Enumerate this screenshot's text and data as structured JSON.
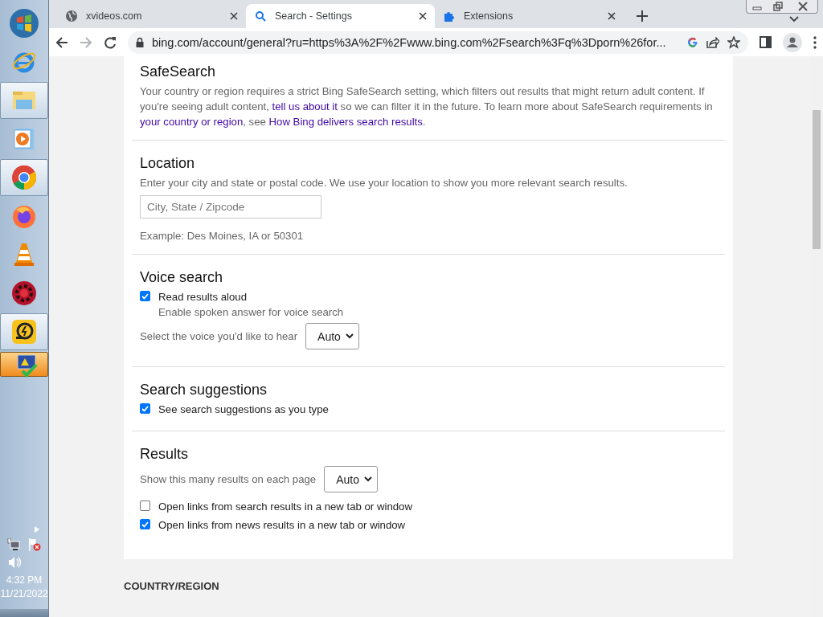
{
  "taskbar": {
    "items": [
      {
        "kind": "start",
        "running": false,
        "selected": false
      },
      {
        "kind": "ie",
        "running": false,
        "selected": false
      },
      {
        "kind": "folder",
        "running": true,
        "selected": false
      },
      {
        "kind": "media",
        "running": false,
        "selected": false
      },
      {
        "kind": "chrome",
        "running": true,
        "selected": false
      },
      {
        "kind": "firefox",
        "running": false,
        "selected": false
      },
      {
        "kind": "cone",
        "running": false,
        "selected": false
      },
      {
        "kind": "gear",
        "running": false,
        "selected": false
      },
      {
        "kind": "remote",
        "running": true,
        "selected": false
      },
      {
        "kind": "monitor",
        "running": true,
        "selected": true
      }
    ],
    "clock": {
      "time": "4:32 PM",
      "date": "11/21/2022"
    }
  },
  "tabs": [
    {
      "kind": "globe",
      "title": "xvideos.com",
      "selected": false
    },
    {
      "kind": "search",
      "title": "Search - Settings",
      "selected": true
    },
    {
      "kind": "puzzle",
      "title": "Extensions",
      "selected": false
    }
  ],
  "address": "bing.com/account/general?ru=https%3A%2F%2Fwww.bing.com%2Fsearch%3Fq%3Dporn%26for...",
  "sections": [
    {
      "title": "SafeSearch",
      "items": [
        {
          "kind": "para",
          "parts": [
            {
              "text": "Your country or region requires a strict Bing SafeSearch setting, which filters out results that might return adult content. If you're seeing adult content, ",
              "link": false
            },
            {
              "text": "tell us about it",
              "link": true
            },
            {
              "text": " so we can filter it in the future. To learn more about SafeSearch requirements in ",
              "link": false
            },
            {
              "text": "your country or region",
              "link": true
            },
            {
              "text": ", see ",
              "link": false
            },
            {
              "text": "How Bing delivers search results",
              "link": true
            },
            {
              "text": ".",
              "link": false
            }
          ]
        }
      ]
    },
    {
      "title": "Location",
      "items": [
        {
          "kind": "text",
          "text": "Enter your city and state or postal code. We use your location to show you more relevant search results."
        },
        {
          "kind": "field",
          "placeholder": "City, State / Zipcode"
        },
        {
          "kind": "note",
          "text": "Example: Des Moines, IA or 50301"
        }
      ]
    },
    {
      "title": "Voice search",
      "items": [
        {
          "kind": "checkbox",
          "label": "Read results aloud",
          "sublabel": "Enable spoken answer for voice search",
          "checked": true
        },
        {
          "kind": "select",
          "label": "Select the voice you'd like to hear",
          "value": "Auto"
        }
      ]
    },
    {
      "title": "Search suggestions",
      "items": [
        {
          "kind": "checkbox",
          "label": "See search suggestions as you type",
          "checked": true
        }
      ]
    },
    {
      "title": "Results",
      "items": [
        {
          "kind": "select",
          "label": "Show this many results on each page",
          "value": "Auto"
        },
        {
          "kind": "checkbox",
          "label": "Open links from search results in a new tab or window",
          "checked": false
        },
        {
          "kind": "checkbox",
          "label": "Open links from news results in a new tab or window",
          "checked": true
        }
      ]
    }
  ],
  "next_heading": "COUNTRY/REGION"
}
